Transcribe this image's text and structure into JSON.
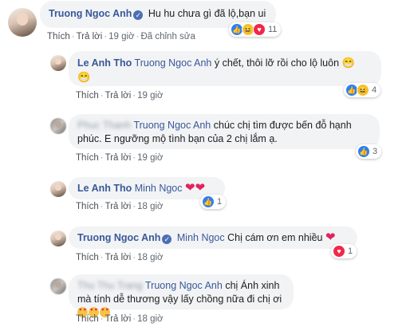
{
  "comments": [
    {
      "author": "Truong Ngoc Anh",
      "verified": true,
      "mention": "",
      "text": "Hu hu chưa gì đã lộ,bạn ui",
      "actions": [
        "Thích",
        "Trả lời",
        "19 giờ",
        "Đã chỉnh sửa"
      ],
      "reactions": {
        "icons": [
          "like",
          "haha",
          "heart"
        ],
        "count": "11"
      }
    },
    {
      "author": "Le Anh Tho",
      "mention": "Truong Ngoc Anh",
      "text": "ý chết, thôi lỡ rồi cho lộ luôn",
      "emoji": [
        "grin",
        "grin"
      ],
      "actions": [
        "Thích",
        "Trả lời",
        "19 giờ"
      ],
      "reactions": {
        "icons": [
          "like",
          "haha"
        ],
        "count": "4"
      }
    },
    {
      "author": "Phuc Thanh",
      "mention": "Truong Ngoc Anh",
      "text": "chúc chị tìm được bến đỗ hạnh phúc. E ngưỡng mộ tình bạn của 2 chị lắm ạ.",
      "actions": [
        "Thích",
        "Trả lời",
        "19 giờ"
      ],
      "reactions": {
        "icons": [
          "like"
        ],
        "count": "3"
      }
    },
    {
      "author": "Le Anh Tho",
      "mention": "Minh Ngoc",
      "text": "",
      "emoji": [
        "heart",
        "heart"
      ],
      "actions": [
        "Thích",
        "Trả lời",
        "18 giờ"
      ],
      "reactions": {
        "icons": [
          "like"
        ],
        "count": "1"
      }
    },
    {
      "author": "Truong Ngoc Anh",
      "verified": true,
      "mention": "Minh Ngoc",
      "text": "Chị cám ơn em nhiều",
      "emoji": [
        "heart"
      ],
      "actions": [
        "Thích",
        "Trả lời",
        "18 giờ"
      ],
      "reactions": {
        "icons": [
          "heart"
        ],
        "count": "1"
      }
    },
    {
      "author": "Thu Thu Trang",
      "mention": "Truong Ngoc Anh",
      "text": "chị Ánh xinh mà tính dễ thương vậy lấy chồng nữa đi chị ơi",
      "emoji": [
        "heart-eyes",
        "heart-eyes",
        "heart-eyes"
      ],
      "actions": [
        "Thích",
        "Trả lời",
        "18 giờ"
      ]
    }
  ],
  "colors": {
    "link": "#385898",
    "like": "#2d7ef7",
    "heart": "#f0284a",
    "bubble": "#f2f3f5"
  }
}
